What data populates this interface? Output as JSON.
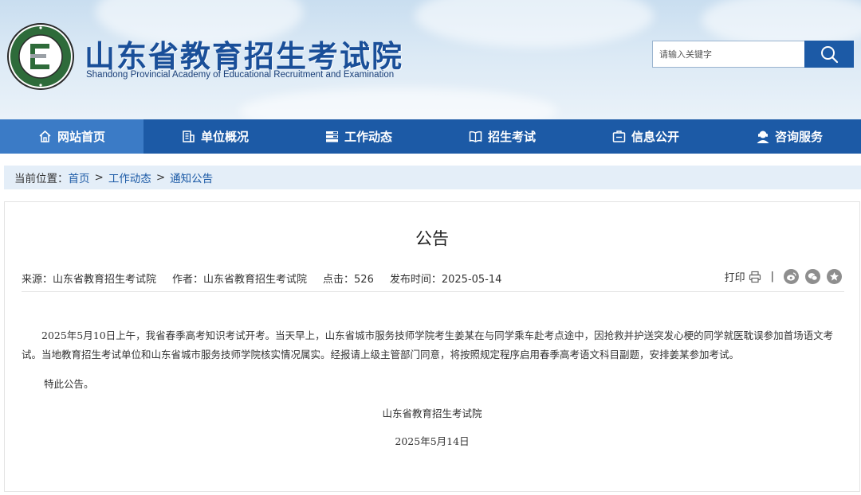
{
  "header": {
    "title": "山东省教育招生考试院",
    "subtitle": "Shandong Provincial Academy of Educational Recruitment and Examination",
    "logo_icon": "seal-logo-icon"
  },
  "search": {
    "placeholder": "请输入关键字",
    "button_icon": "search-icon"
  },
  "nav": {
    "items": [
      {
        "label": "网站首页",
        "icon": "home-icon",
        "active": true
      },
      {
        "label": "单位概况",
        "icon": "building-icon",
        "active": false
      },
      {
        "label": "工作动态",
        "icon": "list-icon",
        "active": false
      },
      {
        "label": "招生考试",
        "icon": "book-icon",
        "active": false
      },
      {
        "label": "信息公开",
        "icon": "info-icon",
        "active": false
      },
      {
        "label": "咨询服务",
        "icon": "user-service-icon",
        "active": false
      }
    ]
  },
  "breadcrumb": {
    "prefix": "当前位置：",
    "items": [
      "首页",
      "工作动态",
      "通知公告"
    ],
    "separator": ">"
  },
  "article": {
    "title": "公告",
    "source": "来源：山东省教育招生考试院",
    "author": "作者：山东省教育招生考试院",
    "clicks": "点击：526",
    "publish_time": "发布时间：2025-05-14",
    "print_label": "打印",
    "tools_separator": "|",
    "paragraph1": "2025年5月10日上午，我省春季高考知识考试开考。当天早上，山东省城市服务技师学院考生姜某在与同学乘车赴考点途中，因抢救并护送突发心梗的同学就医耽误参加首场语文考试。当地教育招生考试单位和山东省城市服务技师学院核实情况属实。经报请上级主管部门同意，将按照规定程序启用春季高考语文科目副题，安排姜某参加考试。",
    "paragraph2": "特此公告。",
    "signature": "山东省教育招生考试院",
    "date": "2025年5月14日"
  },
  "colors": {
    "nav_bg": "#1c5aa6",
    "nav_active": "#3b7bc6",
    "title_blue": "#1a4f99",
    "breadcrumb_bg": "#e4eef8"
  }
}
